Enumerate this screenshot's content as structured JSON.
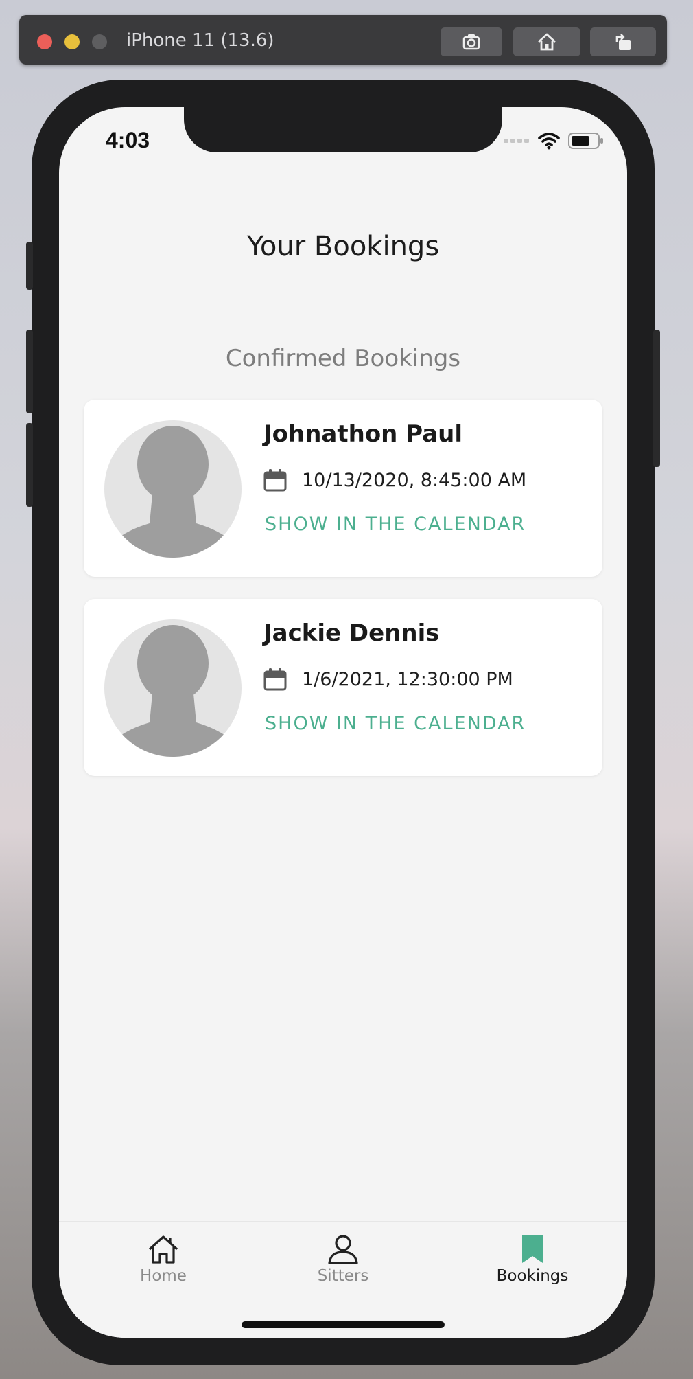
{
  "simulator": {
    "title": "iPhone 11 (13.6)",
    "buttons": [
      "screenshot-icon",
      "home-icon",
      "rotate-icon"
    ]
  },
  "status_bar": {
    "time": "4:03"
  },
  "page": {
    "title": "Your Bookings",
    "section_title": "Confirmed Bookings"
  },
  "bookings": [
    {
      "name": "Johnathon Paul",
      "datetime": "10/13/2020, 8:45:00 AM",
      "action": "SHOW IN THE CALENDAR"
    },
    {
      "name": "Jackie Dennis",
      "datetime": "1/6/2021, 12:30:00 PM",
      "action": "SHOW IN THE CALENDAR"
    }
  ],
  "tabbar": {
    "items": [
      {
        "label": "Home",
        "icon": "home-icon",
        "active": false
      },
      {
        "label": "Sitters",
        "icon": "person-icon",
        "active": false
      },
      {
        "label": "Bookings",
        "icon": "bookmark-icon",
        "active": true
      }
    ]
  },
  "colors": {
    "accent": "#4caf8f",
    "background": "#f4f4f4",
    "card": "#ffffff",
    "muted_text": "#7d7d7d"
  }
}
